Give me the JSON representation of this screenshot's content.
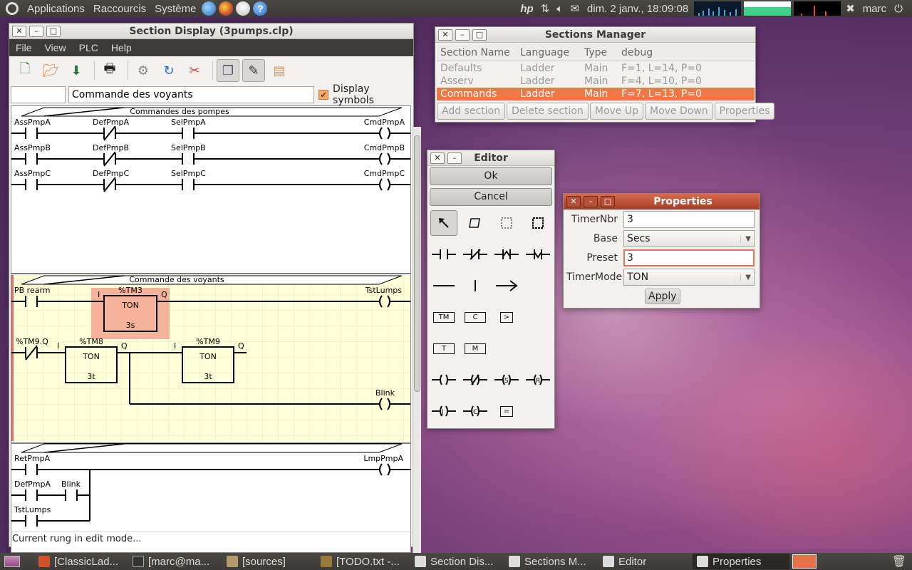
{
  "top_panel": {
    "menus": [
      "Applications",
      "Raccourcis",
      "Système"
    ],
    "clock": "dim. 2 janv., 18:09:08",
    "user": "marc"
  },
  "taskbar": {
    "tasks": [
      "[ClassicLad...",
      "[marc@ma...",
      "[sources]",
      "[TODO.txt -...",
      "Section Dis...",
      "Sections M...",
      "Editor",
      "Properties"
    ]
  },
  "section_display": {
    "title": "Section Display (3pumps.clp)",
    "menus": [
      "File",
      "View",
      "PLC",
      "Help"
    ],
    "rung_number_value": "",
    "rung_label_value": "Commande des voyants",
    "display_symbols_label": "Display symbols",
    "display_symbols_checked": true,
    "status": "Current rung in edit mode...",
    "rungs": [
      {
        "comment": "Commandes des pompes",
        "rows": [
          {
            "contacts": [
              "AssPmpA",
              "DefPmpA",
              "SelPmpA"
            ],
            "coil": "CmdPmpA"
          },
          {
            "contacts": [
              "AssPmpB",
              "DefPmpB",
              "SelPmpB"
            ],
            "coil": "CmdPmpB"
          },
          {
            "contacts": [
              "AssPmpC",
              "DefPmpC",
              "SelPmpC"
            ],
            "coil": "CmdPmpC"
          }
        ]
      },
      {
        "comment": "Commande des voyants",
        "row1_contact": "PB rearm",
        "timer1": {
          "name": "%TM3",
          "mode": "TON",
          "preset": "3s",
          "in": "I",
          "out": "Q"
        },
        "row1_coil": "TstLumps",
        "row2_contact": "%TM9.Q",
        "timer2": {
          "name": "%TM8",
          "mode": "TON",
          "preset": "3t",
          "in": "I",
          "out": "Q"
        },
        "timer3": {
          "name": "%TM9",
          "mode": "TON",
          "preset": "3t",
          "in": "I",
          "out": "Q"
        },
        "row3_coil": "Blink"
      },
      {
        "comment": "",
        "contacts": [
          "RetPmpA",
          "DefPmpA",
          "Blink",
          "TstLumps"
        ],
        "coil": "LmpPmpA"
      }
    ]
  },
  "sections_manager": {
    "title": "Sections Manager",
    "headers": [
      "Section Name",
      "Language",
      "Type",
      "debug"
    ],
    "rows": [
      {
        "name": "Defaults",
        "language": "Ladder",
        "type": "Main",
        "debug": "F=1, L=14, P=0"
      },
      {
        "name": "Asserv",
        "language": "Ladder",
        "type": "Main",
        "debug": "F=4, L=10, P=0"
      },
      {
        "name": "Commands",
        "language": "Ladder",
        "type": "Main",
        "debug": "F=7, L=13, P=0"
      }
    ],
    "buttons": [
      "Add section",
      "Delete section",
      "Move Up",
      "Move Down",
      "Properties"
    ]
  },
  "editor": {
    "title": "Editor",
    "ok_label": "Ok",
    "cancel_label": "Cancel",
    "box_tools": [
      "TM",
      "C",
      ">",
      "T",
      "M",
      "="
    ]
  },
  "properties": {
    "title": "Properties",
    "timernbr_label": "TimerNbr",
    "timernbr_value": "3",
    "base_label": "Base",
    "base_value": "Secs",
    "preset_label": "Preset",
    "preset_value": "3",
    "timermode_label": "TimerMode",
    "timermode_value": "TON",
    "apply_label": "Apply"
  },
  "colors": {
    "accent": "#f07746",
    "edit_rung_bg": "#ffffd8",
    "selected_block": "#f4b39a"
  }
}
